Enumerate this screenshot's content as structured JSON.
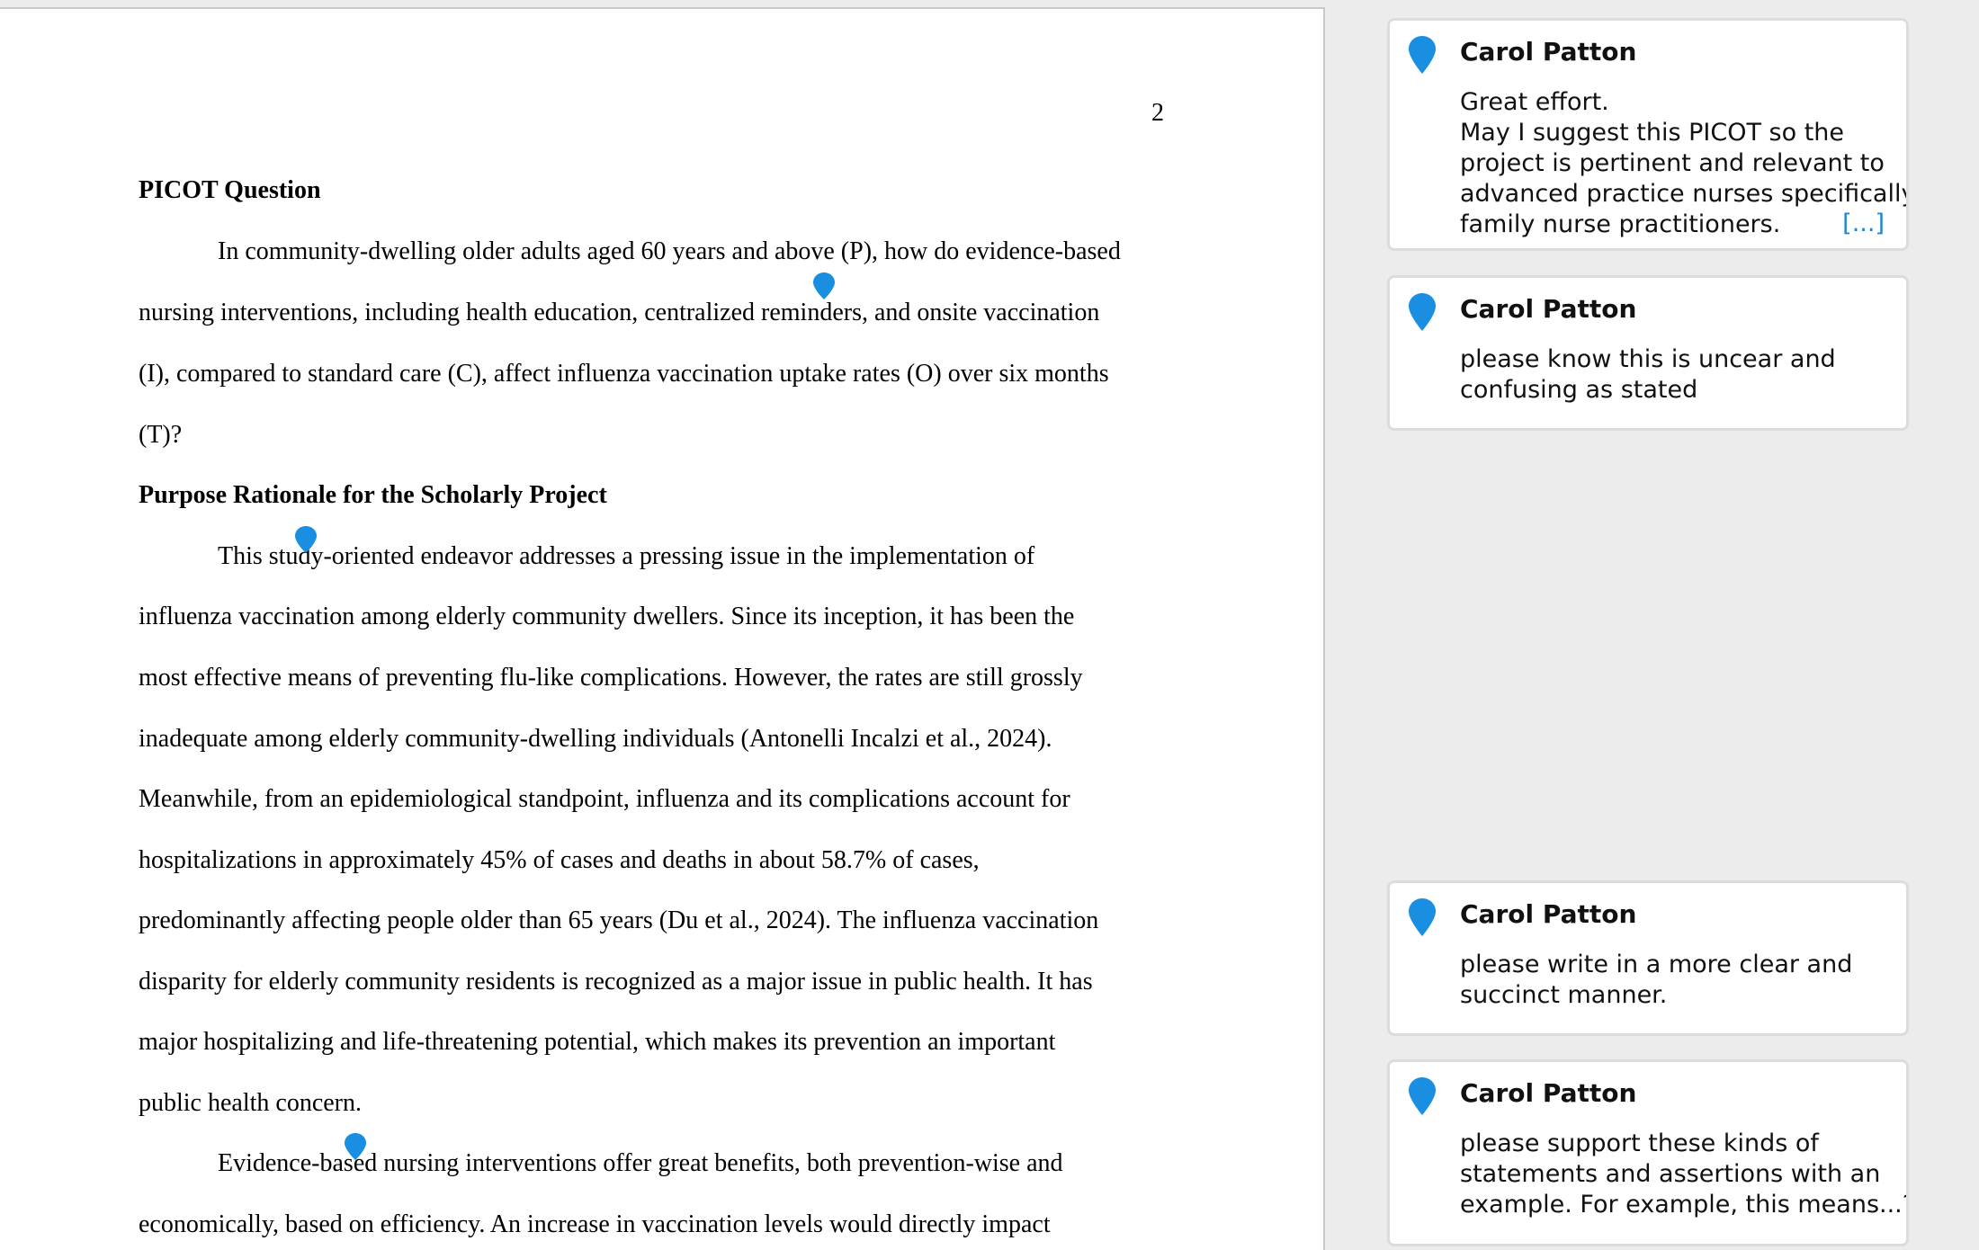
{
  "document": {
    "page_number": "2",
    "lines": [
      {
        "text": "PICOT Question",
        "style": "heading"
      },
      {
        "text": "In community-dwelling older adults aged 60 years and above (P), how do evidence-based",
        "style": "indent"
      },
      {
        "text": "nursing interventions, including health education, centralized reminders, and onsite vaccination",
        "style": "body"
      },
      {
        "text": "(I), compared to standard care (C), affect influenza vaccination uptake rates (O) over six months",
        "style": "body"
      },
      {
        "text": "(T)?",
        "style": "body"
      },
      {
        "text": "Purpose Rationale for the Scholarly Project",
        "style": "heading"
      },
      {
        "text": "This study-oriented endeavor addresses a pressing issue in the implementation of",
        "style": "indent"
      },
      {
        "text": "influenza vaccination among elderly community dwellers. Since its inception, it has been the",
        "style": "body"
      },
      {
        "text": "most effective means of preventing flu-like complications. However, the rates are still grossly",
        "style": "body"
      },
      {
        "text": "inadequate among elderly community-dwelling individuals (Antonelli Incalzi et al., 2024).",
        "style": "body"
      },
      {
        "text": "Meanwhile, from an epidemiological standpoint, influenza and its complications account for",
        "style": "body"
      },
      {
        "text": "hospitalizations in approximately 45% of cases and deaths in about 58.7% of cases,",
        "style": "body"
      },
      {
        "text": "predominantly affecting people older than 65 years (Du et al., 2024). The influenza vaccination",
        "style": "body"
      },
      {
        "text": "disparity for elderly community residents is recognized as a major issue in public health. It has",
        "style": "body"
      },
      {
        "text": "major hospitalizing and life-threatening potential, which makes its prevention an important",
        "style": "body"
      },
      {
        "text": "public health concern.",
        "style": "body"
      },
      {
        "text": "Evidence-based nursing interventions offer great benefits, both prevention-wise and",
        "style": "indent"
      },
      {
        "text": "economically, based on efficiency. An increase in vaccination levels would directly impact",
        "style": "body"
      }
    ]
  },
  "comments": [
    {
      "author": "Carol Patton",
      "lines": [
        "Great effort.",
        "May I suggest this PICOT so the",
        "project is pertinent and relevant to",
        "advanced practice nurses specifically",
        "family nurse practitioners."
      ],
      "more_label": "[...]"
    },
    {
      "author": "Carol Patton",
      "lines": [
        "please know this is uncear and",
        "confusing as stated"
      ]
    },
    {
      "author": "Carol Patton",
      "lines": [
        "please write in a more clear and",
        "succinct manner."
      ]
    },
    {
      "author": "Carol Patton",
      "lines": [
        "please support these kinds of",
        "statements and assertions with an",
        "example. For example, this means...?"
      ]
    }
  ],
  "icons": {
    "comment_anchor": "comment-marker-icon",
    "card_pin": "comment-pin-icon"
  },
  "colors": {
    "marker_blue": "#1a8ee0",
    "link_blue": "#1a86d9"
  }
}
